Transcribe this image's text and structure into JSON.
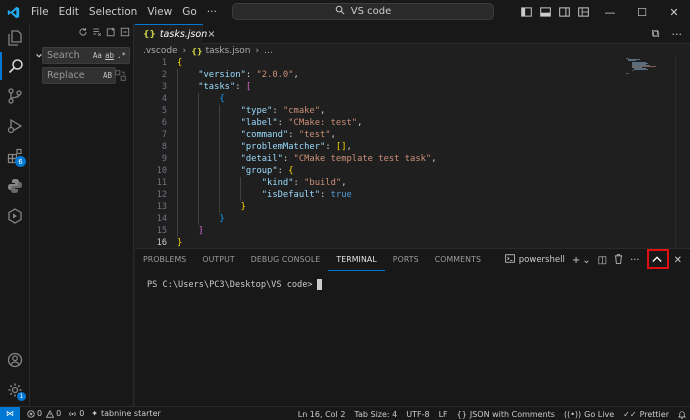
{
  "titlebar": {
    "menus": [
      "File",
      "Edit",
      "Selection",
      "View",
      "Go"
    ],
    "more": "···",
    "back": "←",
    "forward": "→",
    "command_center": "VS code",
    "controls": {
      "minimize": "—",
      "maximize": "☐",
      "close": "✕"
    }
  },
  "activity": {
    "extensions_badge": "6"
  },
  "search": {
    "search_placeholder": "Search",
    "search_opts": [
      "Aa",
      "ab",
      ".*"
    ],
    "replace_placeholder": "Replace",
    "replace_opt": "AB"
  },
  "tabs": [
    {
      "icon": "{}",
      "label": "tasks.json",
      "close": "×"
    }
  ],
  "tab_actions": {
    "split": "⧉",
    "more": "···"
  },
  "breadcrumb": [
    ".vscode",
    "tasks.json",
    "..."
  ],
  "editor": {
    "line_numbers": [
      "1",
      "2",
      "3",
      "4",
      "5",
      "6",
      "7",
      "8",
      "9",
      "10",
      "11",
      "12",
      "13",
      "14",
      "15",
      "16"
    ],
    "current_line": 16,
    "code_lines": [
      [
        [
          "b1",
          "{"
        ]
      ],
      [
        [
          "p",
          "    "
        ],
        [
          "k",
          "\"version\""
        ],
        [
          "p",
          ": "
        ],
        [
          "s",
          "\"2.0.0\""
        ],
        [
          "p",
          ","
        ]
      ],
      [
        [
          "p",
          "    "
        ],
        [
          "k",
          "\"tasks\""
        ],
        [
          "p",
          ": "
        ],
        [
          "b2",
          "["
        ]
      ],
      [
        [
          "p",
          "        "
        ],
        [
          "b3",
          "{"
        ]
      ],
      [
        [
          "p",
          "            "
        ],
        [
          "k",
          "\"type\""
        ],
        [
          "p",
          ": "
        ],
        [
          "s",
          "\"cmake\""
        ],
        [
          "p",
          ","
        ]
      ],
      [
        [
          "p",
          "            "
        ],
        [
          "k",
          "\"label\""
        ],
        [
          "p",
          ": "
        ],
        [
          "s",
          "\"CMake: test\""
        ],
        [
          "p",
          ","
        ]
      ],
      [
        [
          "p",
          "            "
        ],
        [
          "k",
          "\"command\""
        ],
        [
          "p",
          ": "
        ],
        [
          "s",
          "\"test\""
        ],
        [
          "p",
          ","
        ]
      ],
      [
        [
          "p",
          "            "
        ],
        [
          "k",
          "\"problemMatcher\""
        ],
        [
          "p",
          ": "
        ],
        [
          "b1",
          "[]"
        ],
        [
          "p",
          ","
        ]
      ],
      [
        [
          "p",
          "            "
        ],
        [
          "k",
          "\"detail\""
        ],
        [
          "p",
          ": "
        ],
        [
          "s",
          "\"CMake template test task\""
        ],
        [
          "p",
          ","
        ]
      ],
      [
        [
          "p",
          "            "
        ],
        [
          "k",
          "\"group\""
        ],
        [
          "p",
          ": "
        ],
        [
          "b1",
          "{"
        ]
      ],
      [
        [
          "p",
          "                "
        ],
        [
          "k",
          "\"kind\""
        ],
        [
          "p",
          ": "
        ],
        [
          "s",
          "\"build\""
        ],
        [
          "p",
          ","
        ]
      ],
      [
        [
          "p",
          "                "
        ],
        [
          "k",
          "\"isDefault\""
        ],
        [
          "p",
          ": "
        ],
        [
          "kw",
          "true"
        ]
      ],
      [
        [
          "p",
          "            "
        ],
        [
          "b1",
          "}"
        ]
      ],
      [
        [
          "p",
          "        "
        ],
        [
          "b3",
          "}"
        ]
      ],
      [
        [
          "p",
          "    "
        ],
        [
          "b2",
          "]"
        ]
      ],
      [
        [
          "b1",
          "}"
        ]
      ]
    ]
  },
  "panel": {
    "tabs": [
      "PROBLEMS",
      "OUTPUT",
      "DEBUG CONSOLE",
      "TERMINAL",
      "PORTS",
      "COMMENTS"
    ],
    "active_tab": "TERMINAL",
    "shell": "powershell",
    "actions": {
      "add": "+",
      "add_dropdown": "⌄",
      "split": "◫",
      "trash": "🗑",
      "more": "···",
      "maximize": "^",
      "close": "✕"
    },
    "terminal_prompt": "PS C:\\Users\\PC3\\Desktop\\VS code>"
  },
  "status": {
    "remote": "⋈",
    "errors": "0",
    "warnings": "0",
    "ports": "0",
    "tabnine": "tabnine starter",
    "cursor_pos": "Ln 16, Col 2",
    "tab_size": "Tab Size: 4",
    "encoding": "UTF-8",
    "eol": "LF",
    "language": "JSON with Comments",
    "go_live": "Go Live",
    "prettier": "Prettier"
  },
  "colors": {
    "accent": "#0078d4",
    "highlight": "#e01010",
    "json_icon": "#cbcb41"
  }
}
